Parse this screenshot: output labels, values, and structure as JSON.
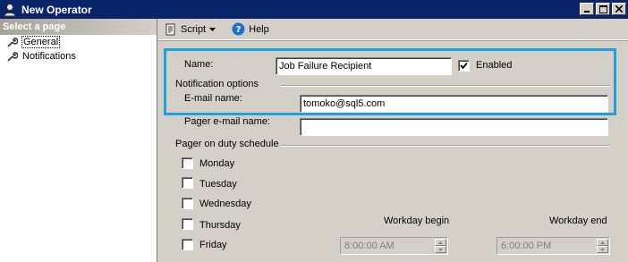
{
  "window": {
    "title": "New Operator"
  },
  "sidebar": {
    "header": "Select a page",
    "items": [
      {
        "label": "General",
        "icon": "wrench-icon",
        "selected": true
      },
      {
        "label": "Notifications",
        "icon": "wrench-icon",
        "selected": false
      }
    ]
  },
  "toolbar": {
    "script_label": "Script",
    "help_label": "Help"
  },
  "form": {
    "name_label": "Name:",
    "name_value": "Job Failure Recipient",
    "enabled_label": "Enabled",
    "enabled_checked": true,
    "notification_group": "Notification options",
    "email_label": "E-mail name:",
    "email_value": "tomoko@sql5.com",
    "pager_email_label": "Pager e-mail name:",
    "pager_email_value": "",
    "pager_schedule_group": "Pager on duty schedule",
    "days": [
      {
        "label": "Monday",
        "checked": false
      },
      {
        "label": "Tuesday",
        "checked": false
      },
      {
        "label": "Wednesday",
        "checked": false
      },
      {
        "label": "Thursday",
        "checked": false
      },
      {
        "label": "Friday",
        "checked": false
      }
    ],
    "workday_begin_label": "Workday begin",
    "workday_end_label": "Workday end",
    "friday_begin": "8:00:00 AM",
    "friday_end": "6:00:00 PM"
  },
  "colors": {
    "highlight": "#1ba0e0",
    "titlebar": "#0a246a"
  }
}
